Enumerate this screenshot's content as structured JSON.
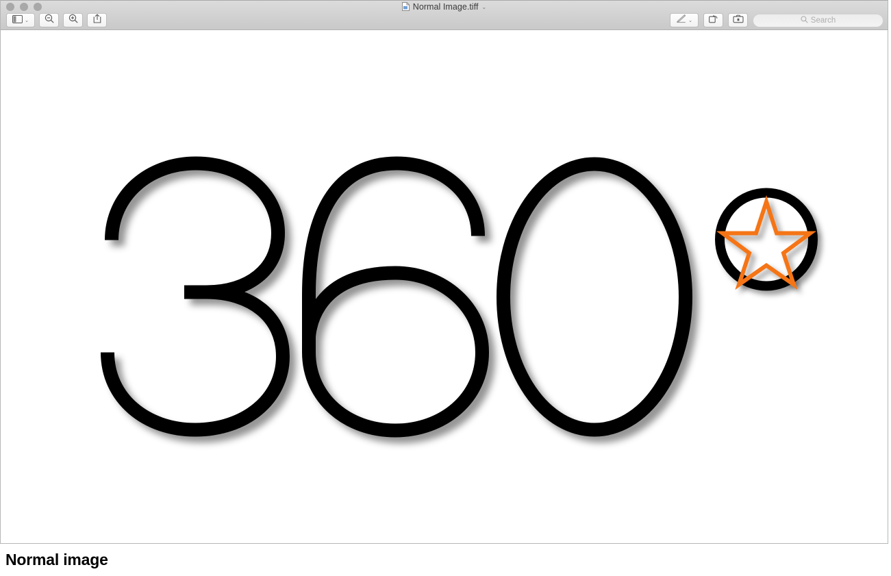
{
  "window": {
    "title": "Normal Image.tiff",
    "title_icon": "document-icon",
    "title_chevron": "⌄",
    "traffic_lights": [
      {
        "name": "close",
        "color": "#a8a8a8"
      },
      {
        "name": "minimize",
        "color": "#a8a8a8"
      },
      {
        "name": "zoom",
        "color": "#a8a8a8"
      }
    ]
  },
  "toolbar": {
    "left": [
      {
        "name": "sidebar-toggle",
        "icon": "sidebar-icon",
        "chevron": "⌄"
      },
      {
        "name": "zoom-out",
        "icon": "zoom-out-icon"
      },
      {
        "name": "zoom-in",
        "icon": "zoom-in-icon"
      },
      {
        "name": "share",
        "icon": "share-icon"
      }
    ],
    "right": [
      {
        "name": "markup",
        "icon": "pen-icon",
        "chevron": "⌄"
      },
      {
        "name": "rotate-left",
        "icon": "rotate-left-icon"
      },
      {
        "name": "toolbox",
        "icon": "toolbox-icon"
      }
    ],
    "search": {
      "icon": "search-icon",
      "placeholder": "Search",
      "value": ""
    }
  },
  "image": {
    "alt": "360 degree symbol with star",
    "text": "360",
    "degree_mark": "circle-with-star",
    "star_color": "#F57517",
    "stroke_color": "#000000",
    "background": "#FFFFFF"
  },
  "caption": {
    "text": "Normal image"
  }
}
